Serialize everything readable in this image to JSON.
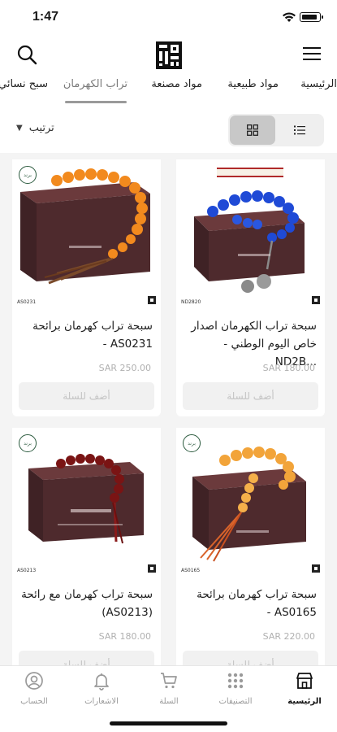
{
  "status_bar": {
    "time": "1:47"
  },
  "categories": {
    "items": [
      {
        "label": "الرئيسية",
        "active": false
      },
      {
        "label": "مواد طبيعية",
        "active": false
      },
      {
        "label": "مواد مصنعة",
        "active": false
      },
      {
        "label": "تراب الكهرمان",
        "active": true
      },
      {
        "label": "سبح نسائي",
        "active": false
      }
    ]
  },
  "toolbar": {
    "sort_label": "ترتيب"
  },
  "products": [
    {
      "sku": "ND2820",
      "title": "سبحة تراب الكهرمان اصدار خاص اليوم الوطني - ...ND2B",
      "price": "SAR 180.00",
      "button": "أضف للسلة",
      "beads_color": "#1f4ad6",
      "tassel_color": "#8a8a8a",
      "badge": ""
    },
    {
      "sku": "AS0231",
      "title": "سبحة تراب كهرمان برائحة AS0231 -",
      "price": "SAR 250.00",
      "button": "أضف للسلة",
      "beads_color": "#f28a1e",
      "tassel_color": "#7a4a2a",
      "badge": "برند"
    },
    {
      "sku": "AS0165",
      "title": "سبحة تراب كهرمان برائحة AS0165 -",
      "price": "SAR 220.00",
      "button": "أضف للسلة",
      "beads_color": "#f2a43a",
      "tassel_color": "#d9632a",
      "badge": "برند"
    },
    {
      "sku": "AS0213",
      "title": "سبحة تراب كهرمان مع رائحة (AS0213)",
      "price": "SAR 180.00",
      "button": "أضف للسلة",
      "beads_color": "#7a1414",
      "tassel_color": "#8a1a1a",
      "badge": "برند"
    }
  ],
  "bottom_nav": {
    "items": [
      {
        "label": "الرئيسية",
        "icon": "store-icon",
        "active": true
      },
      {
        "label": "التصنيفات",
        "icon": "grid-dots-icon",
        "active": false
      },
      {
        "label": "السلة",
        "icon": "cart-icon",
        "active": false
      },
      {
        "label": "الاشعارات",
        "icon": "bell-icon",
        "active": false
      },
      {
        "label": "الحساب",
        "icon": "account-icon",
        "active": false
      }
    ]
  }
}
